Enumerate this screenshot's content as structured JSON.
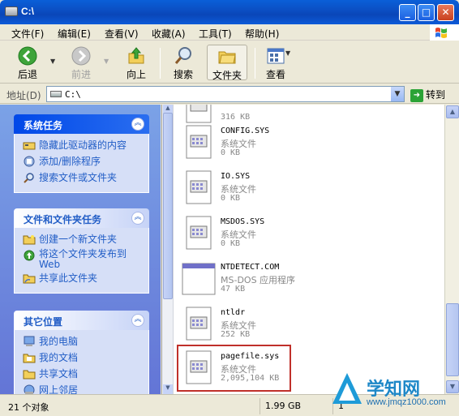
{
  "window": {
    "title": "C:\\"
  },
  "menubar": {
    "items": [
      "文件(F)",
      "编辑(E)",
      "查看(V)",
      "收藏(A)",
      "工具(T)",
      "帮助(H)"
    ]
  },
  "toolbar": {
    "back": "后退",
    "forward": "前进",
    "up": "向上",
    "search": "搜索",
    "folders": "文件夹",
    "views": "查看"
  },
  "address": {
    "label": "地址(D)",
    "value": "C:\\",
    "go": "转到"
  },
  "panels": {
    "system_tasks": {
      "title": "系统任务",
      "items": [
        "隐藏此驱动器的内容",
        "添加/删除程序",
        "搜索文件或文件夹"
      ]
    },
    "file_tasks": {
      "title": "文件和文件夹任务",
      "items": [
        "创建一个新文件夹",
        "将这个文件夹发布到",
        "Web",
        "共享此文件夹"
      ]
    },
    "other_places": {
      "title": "其它位置",
      "items": [
        "我的电脑",
        "我的文档",
        "共享文档",
        "网上邻居"
      ]
    }
  },
  "files": [
    {
      "name": "",
      "type": "",
      "size": "316 KB"
    },
    {
      "name": "CONFIG.SYS",
      "type": "系统文件",
      "size": "0 KB"
    },
    {
      "name": "IO.SYS",
      "type": "系统文件",
      "size": "0 KB"
    },
    {
      "name": "MSDOS.SYS",
      "type": "系统文件",
      "size": "0 KB"
    },
    {
      "name": "NTDETECT.COM",
      "type": "MS-DOS 应用程序",
      "size": "47 KB"
    },
    {
      "name": "ntldr",
      "type": "系统文件",
      "size": "252 KB"
    },
    {
      "name": "pagefile.sys",
      "type": "系统文件",
      "size": "2,095,104 KB"
    }
  ],
  "statusbar": {
    "objects": "21 个对象",
    "size": "1.99 GB",
    "extra": "1"
  },
  "watermark": {
    "text": "学知网",
    "url": "www.jmqz1000.com"
  },
  "colors": {
    "title": "#0a4fc4",
    "task_text": "#215dc6",
    "highlight": "#c0302a"
  }
}
